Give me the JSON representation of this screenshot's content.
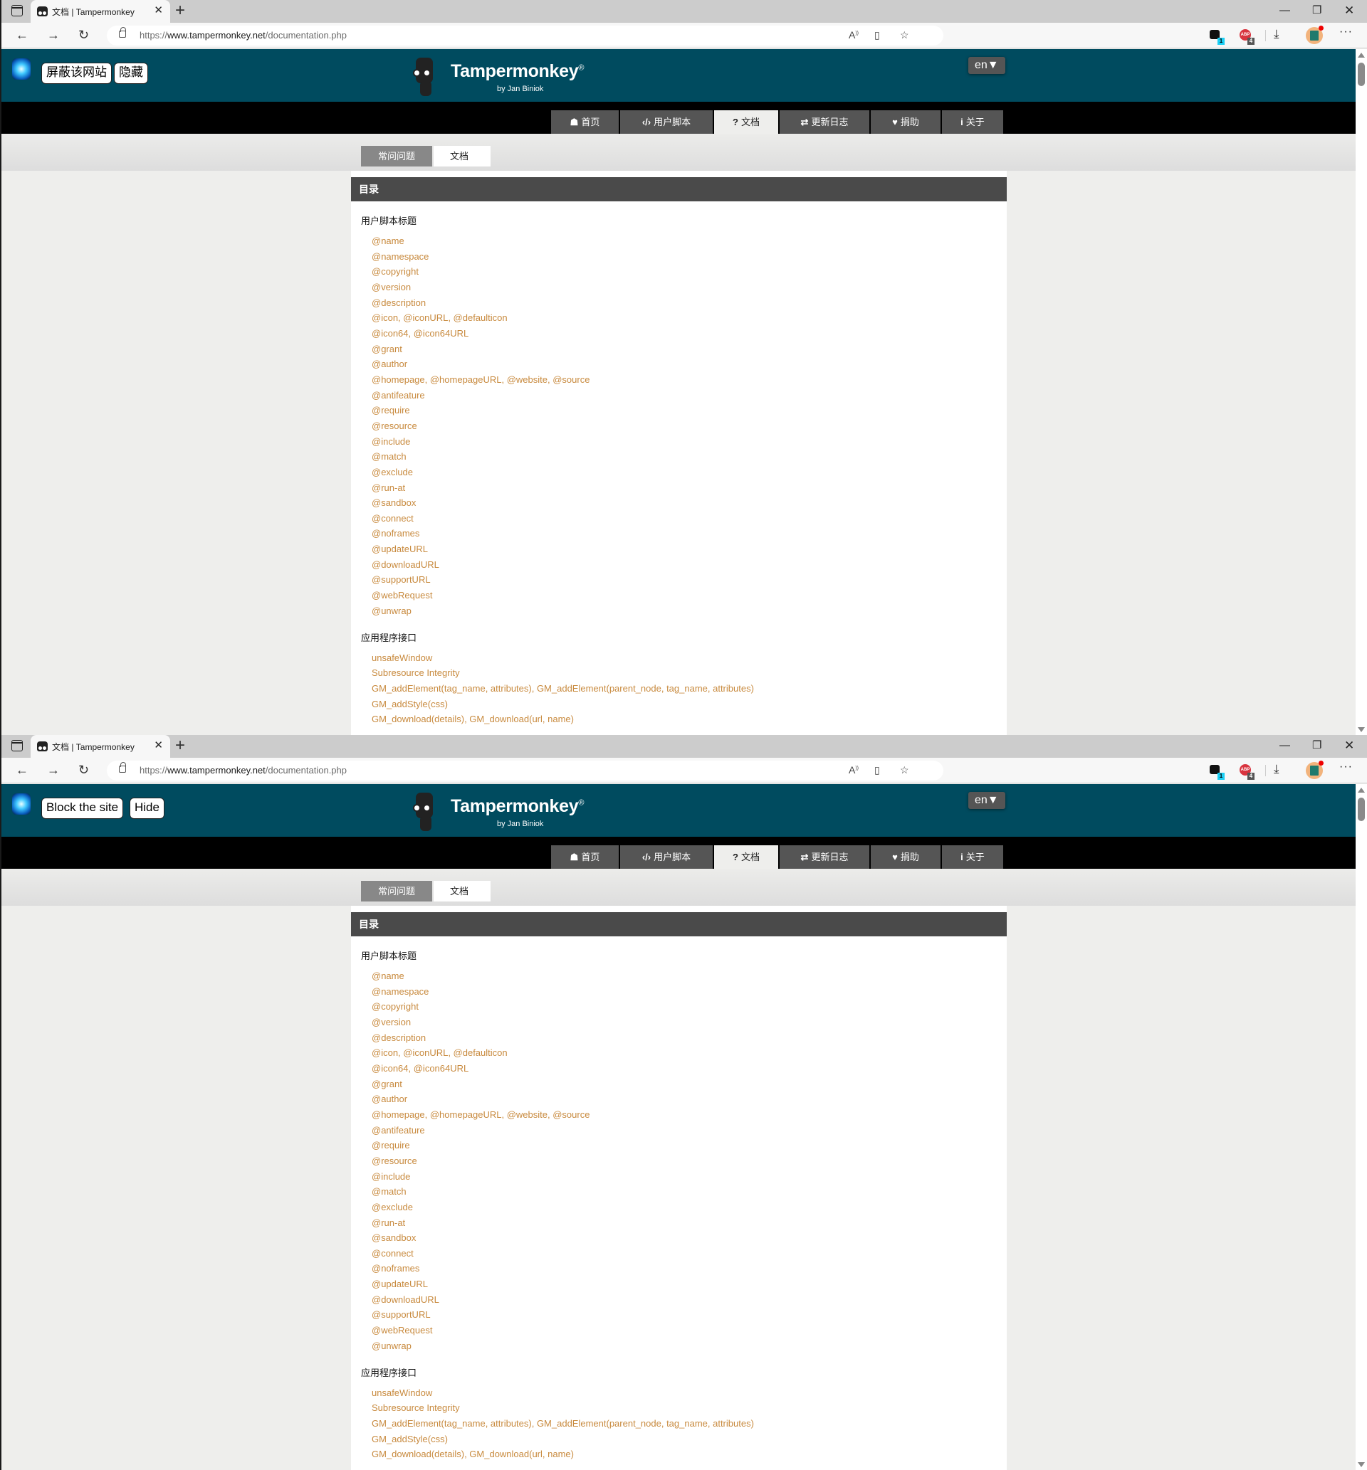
{
  "windows": [
    {
      "browser": {
        "tab_title": "文档 | Tampermonkey",
        "url_scheme": "https://",
        "url_host": "www.tampermonkey.net",
        "url_path": "/documentation.php",
        "extension_badges": {
          "tampermonkey": "1",
          "adblock": "4"
        }
      },
      "blocker": {
        "block_label": "屏蔽该网站",
        "hide_label": "隐藏"
      }
    },
    {
      "browser": {
        "tab_title": "文档 | Tampermonkey",
        "url_scheme": "https://",
        "url_host": "www.tampermonkey.net",
        "url_path": "/documentation.php",
        "extension_badges": {
          "tampermonkey": "1",
          "adblock": "4"
        }
      },
      "blocker": {
        "block_label": "Block the site",
        "hide_label": "Hide"
      }
    }
  ],
  "site": {
    "title": "Tampermonkey",
    "trademark": "®",
    "subtitle": "by Jan Biniok",
    "language": "en▼",
    "nav": [
      {
        "icon": "home-icon",
        "glyph": "☗",
        "label": "首页"
      },
      {
        "icon": "code-icon",
        "glyph": "‹/›",
        "label": "用户脚本"
      },
      {
        "icon": "question-icon",
        "glyph": "?",
        "label": "文档",
        "active": true
      },
      {
        "icon": "swap-icon",
        "glyph": "⇄",
        "label": "更新日志"
      },
      {
        "icon": "heart-icon",
        "glyph": "♥",
        "label": "捐助"
      },
      {
        "icon": "info-icon",
        "glyph": "i",
        "label": "关于"
      }
    ],
    "sub_tabs": [
      {
        "label": "常问问题",
        "active": false
      },
      {
        "label": "文档",
        "active": true
      }
    ]
  },
  "toc": {
    "header": "目录",
    "sections": [
      {
        "title": "用户脚本标题",
        "items": [
          "@name",
          "@namespace",
          "@copyright",
          "@version",
          "@description",
          "@icon, @iconURL, @defaulticon",
          "@icon64, @icon64URL",
          "@grant",
          "@author",
          "@homepage, @homepageURL, @website, @source",
          "@antifeature",
          "@require",
          "@resource",
          "@include",
          "@match",
          "@exclude",
          "@run-at",
          "@sandbox",
          "@connect",
          "@noframes",
          "@updateURL",
          "@downloadURL",
          "@supportURL",
          "@webRequest",
          "@unwrap"
        ]
      },
      {
        "title": "应用程序接口",
        "items": [
          "unsafeWindow",
          "Subresource Integrity",
          "GM_addElement(tag_name, attributes), GM_addElement(parent_node, tag_name, attributes)",
          "GM_addStyle(css)",
          "GM_download(details), GM_download(url, name)"
        ]
      }
    ]
  },
  "colors": {
    "header_bg": "#004b5f",
    "link": "#c88a3e",
    "nav_tab_bg": "#555555",
    "toc_header_bg": "#4a4a4a"
  }
}
